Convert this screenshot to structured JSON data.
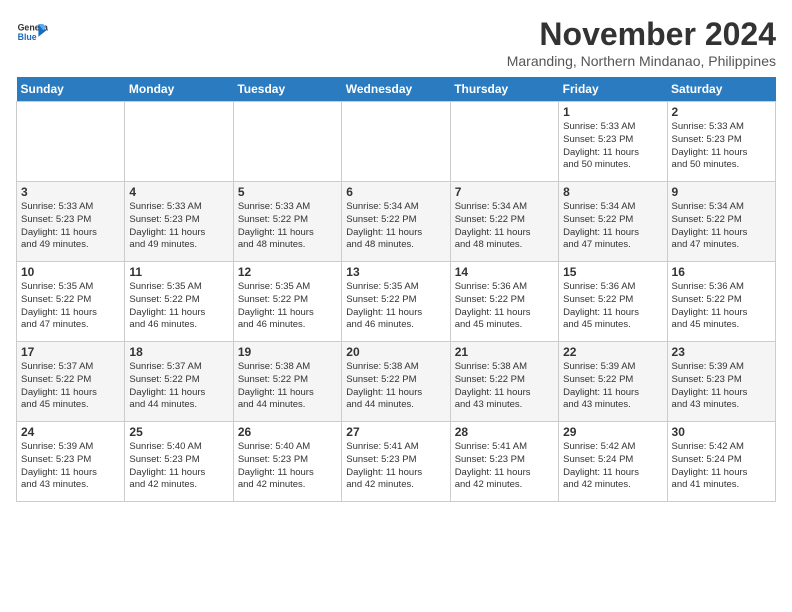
{
  "header": {
    "logo_line1": "General",
    "logo_line2": "Blue",
    "month": "November 2024",
    "location": "Maranding, Northern Mindanao, Philippines"
  },
  "days_of_week": [
    "Sunday",
    "Monday",
    "Tuesday",
    "Wednesday",
    "Thursday",
    "Friday",
    "Saturday"
  ],
  "weeks": [
    [
      {
        "day": "",
        "info": ""
      },
      {
        "day": "",
        "info": ""
      },
      {
        "day": "",
        "info": ""
      },
      {
        "day": "",
        "info": ""
      },
      {
        "day": "",
        "info": ""
      },
      {
        "day": "1",
        "info": "Sunrise: 5:33 AM\nSunset: 5:23 PM\nDaylight: 11 hours\nand 50 minutes."
      },
      {
        "day": "2",
        "info": "Sunrise: 5:33 AM\nSunset: 5:23 PM\nDaylight: 11 hours\nand 50 minutes."
      }
    ],
    [
      {
        "day": "3",
        "info": "Sunrise: 5:33 AM\nSunset: 5:23 PM\nDaylight: 11 hours\nand 49 minutes."
      },
      {
        "day": "4",
        "info": "Sunrise: 5:33 AM\nSunset: 5:23 PM\nDaylight: 11 hours\nand 49 minutes."
      },
      {
        "day": "5",
        "info": "Sunrise: 5:33 AM\nSunset: 5:22 PM\nDaylight: 11 hours\nand 48 minutes."
      },
      {
        "day": "6",
        "info": "Sunrise: 5:34 AM\nSunset: 5:22 PM\nDaylight: 11 hours\nand 48 minutes."
      },
      {
        "day": "7",
        "info": "Sunrise: 5:34 AM\nSunset: 5:22 PM\nDaylight: 11 hours\nand 48 minutes."
      },
      {
        "day": "8",
        "info": "Sunrise: 5:34 AM\nSunset: 5:22 PM\nDaylight: 11 hours\nand 47 minutes."
      },
      {
        "day": "9",
        "info": "Sunrise: 5:34 AM\nSunset: 5:22 PM\nDaylight: 11 hours\nand 47 minutes."
      }
    ],
    [
      {
        "day": "10",
        "info": "Sunrise: 5:35 AM\nSunset: 5:22 PM\nDaylight: 11 hours\nand 47 minutes."
      },
      {
        "day": "11",
        "info": "Sunrise: 5:35 AM\nSunset: 5:22 PM\nDaylight: 11 hours\nand 46 minutes."
      },
      {
        "day": "12",
        "info": "Sunrise: 5:35 AM\nSunset: 5:22 PM\nDaylight: 11 hours\nand 46 minutes."
      },
      {
        "day": "13",
        "info": "Sunrise: 5:35 AM\nSunset: 5:22 PM\nDaylight: 11 hours\nand 46 minutes."
      },
      {
        "day": "14",
        "info": "Sunrise: 5:36 AM\nSunset: 5:22 PM\nDaylight: 11 hours\nand 45 minutes."
      },
      {
        "day": "15",
        "info": "Sunrise: 5:36 AM\nSunset: 5:22 PM\nDaylight: 11 hours\nand 45 minutes."
      },
      {
        "day": "16",
        "info": "Sunrise: 5:36 AM\nSunset: 5:22 PM\nDaylight: 11 hours\nand 45 minutes."
      }
    ],
    [
      {
        "day": "17",
        "info": "Sunrise: 5:37 AM\nSunset: 5:22 PM\nDaylight: 11 hours\nand 45 minutes."
      },
      {
        "day": "18",
        "info": "Sunrise: 5:37 AM\nSunset: 5:22 PM\nDaylight: 11 hours\nand 44 minutes."
      },
      {
        "day": "19",
        "info": "Sunrise: 5:38 AM\nSunset: 5:22 PM\nDaylight: 11 hours\nand 44 minutes."
      },
      {
        "day": "20",
        "info": "Sunrise: 5:38 AM\nSunset: 5:22 PM\nDaylight: 11 hours\nand 44 minutes."
      },
      {
        "day": "21",
        "info": "Sunrise: 5:38 AM\nSunset: 5:22 PM\nDaylight: 11 hours\nand 43 minutes."
      },
      {
        "day": "22",
        "info": "Sunrise: 5:39 AM\nSunset: 5:22 PM\nDaylight: 11 hours\nand 43 minutes."
      },
      {
        "day": "23",
        "info": "Sunrise: 5:39 AM\nSunset: 5:23 PM\nDaylight: 11 hours\nand 43 minutes."
      }
    ],
    [
      {
        "day": "24",
        "info": "Sunrise: 5:39 AM\nSunset: 5:23 PM\nDaylight: 11 hours\nand 43 minutes."
      },
      {
        "day": "25",
        "info": "Sunrise: 5:40 AM\nSunset: 5:23 PM\nDaylight: 11 hours\nand 42 minutes."
      },
      {
        "day": "26",
        "info": "Sunrise: 5:40 AM\nSunset: 5:23 PM\nDaylight: 11 hours\nand 42 minutes."
      },
      {
        "day": "27",
        "info": "Sunrise: 5:41 AM\nSunset: 5:23 PM\nDaylight: 11 hours\nand 42 minutes."
      },
      {
        "day": "28",
        "info": "Sunrise: 5:41 AM\nSunset: 5:23 PM\nDaylight: 11 hours\nand 42 minutes."
      },
      {
        "day": "29",
        "info": "Sunrise: 5:42 AM\nSunset: 5:24 PM\nDaylight: 11 hours\nand 42 minutes."
      },
      {
        "day": "30",
        "info": "Sunrise: 5:42 AM\nSunset: 5:24 PM\nDaylight: 11 hours\nand 41 minutes."
      }
    ]
  ]
}
